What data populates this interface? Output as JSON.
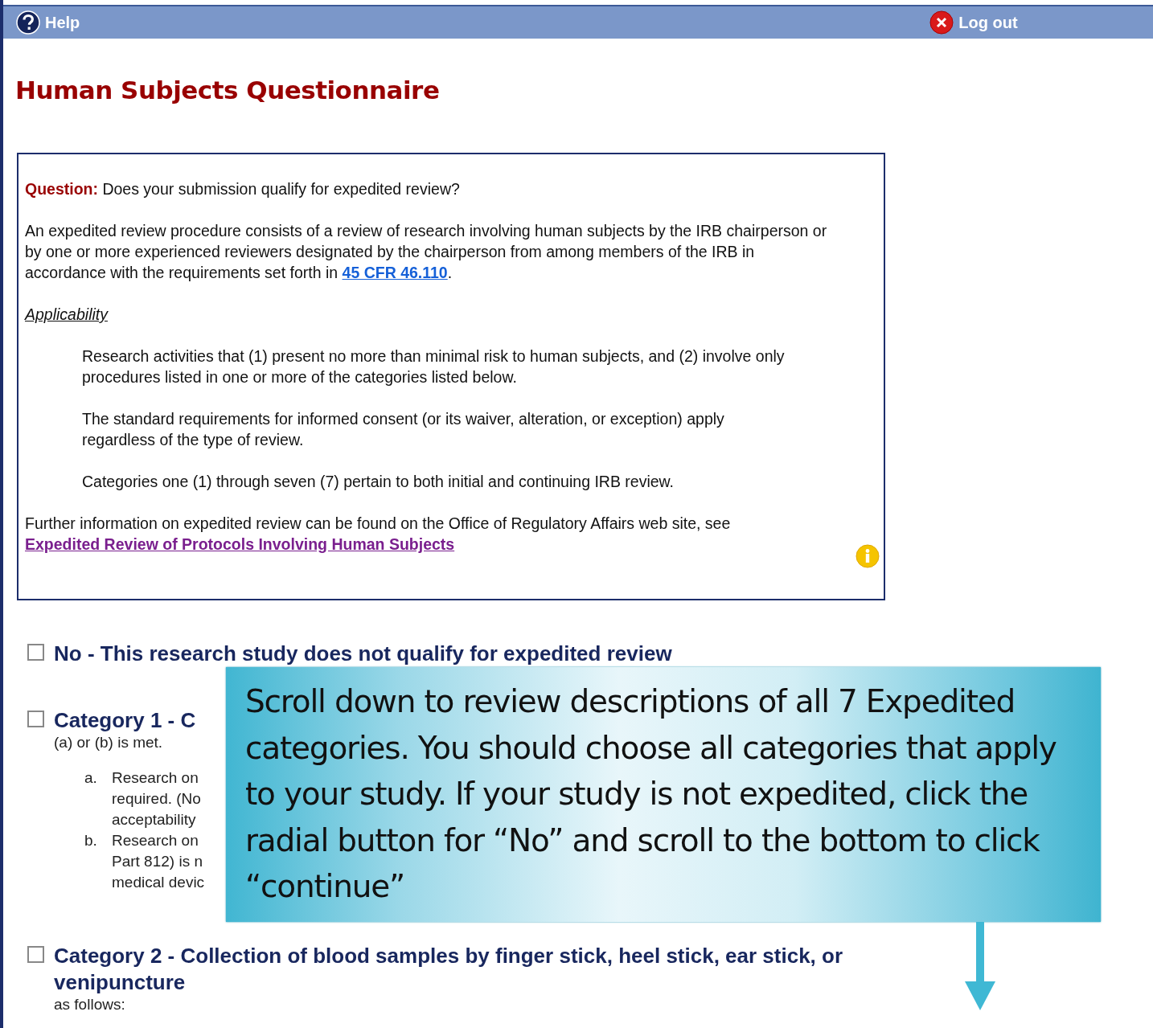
{
  "header": {
    "help_label": "Help",
    "logout_label": "Log out"
  },
  "title": "Human Subjects Questionnaire",
  "question": {
    "label": "Question:",
    "text": "Does your submission qualify for expedited review?",
    "intro_before": "An expedited review procedure consists of a review of research involving human subjects by the IRB chairperson or by one or more experienced reviewers designated by the chairperson from among members of the IRB in accordance with the requirements set forth in",
    "intro_link": "45 CFR 46.110",
    "intro_after": ".",
    "applicability": "Applicability",
    "indented": [
      "Research activities that (1) present no more than minimal risk to human subjects, and (2) involve only procedures listed in one or more of the categories listed below.",
      "The standard requirements for informed consent (or its waiver, alteration, or exception) apply regardless of the type of review.",
      "Categories one (1) through seven (7) pertain to both initial and continuing IRB review."
    ],
    "further_text": "Further information on expedited review can be found on the Office of Regulatory Affairs web site, see",
    "further_link": "Expedited Review of Protocols Involving Human Subjects"
  },
  "options": [
    {
      "label": "No - This research study does not qualify for expedited review",
      "checked": false
    },
    {
      "label": "Category 1 - C",
      "checked": false,
      "description": "(a) or (b) is met.",
      "items": [
        {
          "marker": "a.",
          "lines": [
            "Research on",
            "required. (No",
            "acceptability"
          ]
        },
        {
          "marker": "b.",
          "lines": [
            "Research on",
            "Part 812) is n",
            "medical devic"
          ]
        }
      ]
    },
    {
      "label": "Category 2 - Collection of blood samples by finger stick, heel stick, ear stick, or venipuncture",
      "checked": false,
      "description": "as follows:"
    }
  ],
  "callout": {
    "text": "Scroll down to review descriptions of all 7 Expedited categories. You should choose all categories that apply to your study. If your study is not expedited, click the radial button for “No” and scroll to the bottom to click “continue”"
  }
}
